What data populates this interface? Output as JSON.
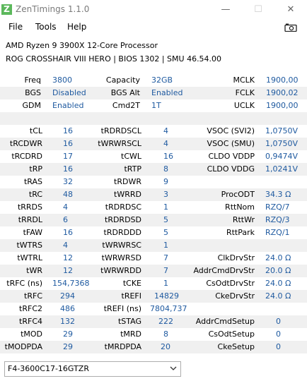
{
  "window": {
    "title": "ZenTimings 1.1.0",
    "icon_letter": "Z",
    "minimize": "—",
    "maximize": "☐",
    "close": "✕"
  },
  "menu": {
    "file": "File",
    "tools": "Tools",
    "help": "Help"
  },
  "info": {
    "cpu": "AMD Ryzen 9 3900X 12-Core Processor",
    "board": "ROG CROSSHAIR VIII HERO | BIOS 1302 | SMU 46.54.00"
  },
  "top": [
    {
      "l1": "Freq",
      "v1": "3800",
      "l2": "Capacity",
      "v2": "32GB",
      "l3": "MCLK",
      "v3": "1900,00"
    },
    {
      "l1": "BGS",
      "v1": "Disabled",
      "l2": "BGS Alt",
      "v2": "Enabled",
      "l3": "FCLK",
      "v3": "1900,02"
    },
    {
      "l1": "GDM",
      "v1": "Enabled",
      "l2": "Cmd2T",
      "v2": "1T",
      "l3": "UCLK",
      "v3": "1900,00"
    }
  ],
  "timings": [
    {
      "l1": "tCL",
      "v1": "16",
      "l2": "tRDRDSCL",
      "v2": "4",
      "l3": "VSOC (SVI2)",
      "v3": "1,0750V"
    },
    {
      "l1": "tRCDWR",
      "v1": "16",
      "l2": "tWRWRSCL",
      "v2": "4",
      "l3": "VSOC (SMU)",
      "v3": "1,0750V"
    },
    {
      "l1": "tRCDRD",
      "v1": "17",
      "l2": "tCWL",
      "v2": "16",
      "l3": "CLDO VDDP",
      "v3": "0,9474V"
    },
    {
      "l1": "tRP",
      "v1": "16",
      "l2": "tRTP",
      "v2": "8",
      "l3": "CLDO VDDG",
      "v3": "1,0241V"
    },
    {
      "l1": "tRAS",
      "v1": "32",
      "l2": "tRDWR",
      "v2": "9",
      "l3": "",
      "v3": ""
    },
    {
      "l1": "tRC",
      "v1": "48",
      "l2": "tWRRD",
      "v2": "3",
      "l3": "ProcODT",
      "v3": "34.3 Ω"
    },
    {
      "l1": "tRRDS",
      "v1": "4",
      "l2": "tRDRDSC",
      "v2": "1",
      "l3": "RttNom",
      "v3": "RZQ/7"
    },
    {
      "l1": "tRRDL",
      "v1": "6",
      "l2": "tRDRDSD",
      "v2": "5",
      "l3": "RttWr",
      "v3": "RZQ/3"
    },
    {
      "l1": "tFAW",
      "v1": "16",
      "l2": "tRDRDDD",
      "v2": "5",
      "l3": "RttPark",
      "v3": "RZQ/1"
    },
    {
      "l1": "tWTRS",
      "v1": "4",
      "l2": "tWRWRSC",
      "v2": "1",
      "l3": "",
      "v3": ""
    },
    {
      "l1": "tWTRL",
      "v1": "12",
      "l2": "tWRWRSD",
      "v2": "7",
      "l3": "ClkDrvStr",
      "v3": "24.0 Ω"
    },
    {
      "l1": "tWR",
      "v1": "12",
      "l2": "tWRWRDD",
      "v2": "7",
      "l3": "AddrCmdDrvStr",
      "v3": "20.0 Ω"
    },
    {
      "l1": "tRFC (ns)",
      "v1": "154,7368",
      "l2": "tCKE",
      "v2": "1",
      "l3": "CsOdtDrvStr",
      "v3": "24.0 Ω"
    },
    {
      "l1": "tRFC",
      "v1": "294",
      "l2": "tREFI",
      "v2": "14829",
      "l3": "CkeDrvStr",
      "v3": "24.0 Ω"
    },
    {
      "l1": "tRFC2",
      "v1": "486",
      "l2": "tREFI (ns)",
      "v2": "7804,737",
      "l3": "",
      "v3": ""
    },
    {
      "l1": "tRFC4",
      "v1": "132",
      "l2": "tSTAG",
      "v2": "222",
      "l3": "AddrCmdSetup",
      "v3": "0"
    },
    {
      "l1": "tMOD",
      "v1": "29",
      "l2": "tMRD",
      "v2": "8",
      "l3": "CsOdtSetup",
      "v3": "0"
    },
    {
      "l1": "tMODPDA",
      "v1": "29",
      "l2": "tMRDPDA",
      "v2": "20",
      "l3": "CkeSetup",
      "v3": "0"
    }
  ],
  "profile": {
    "selected": "F4-3600C17-16GTZR"
  }
}
